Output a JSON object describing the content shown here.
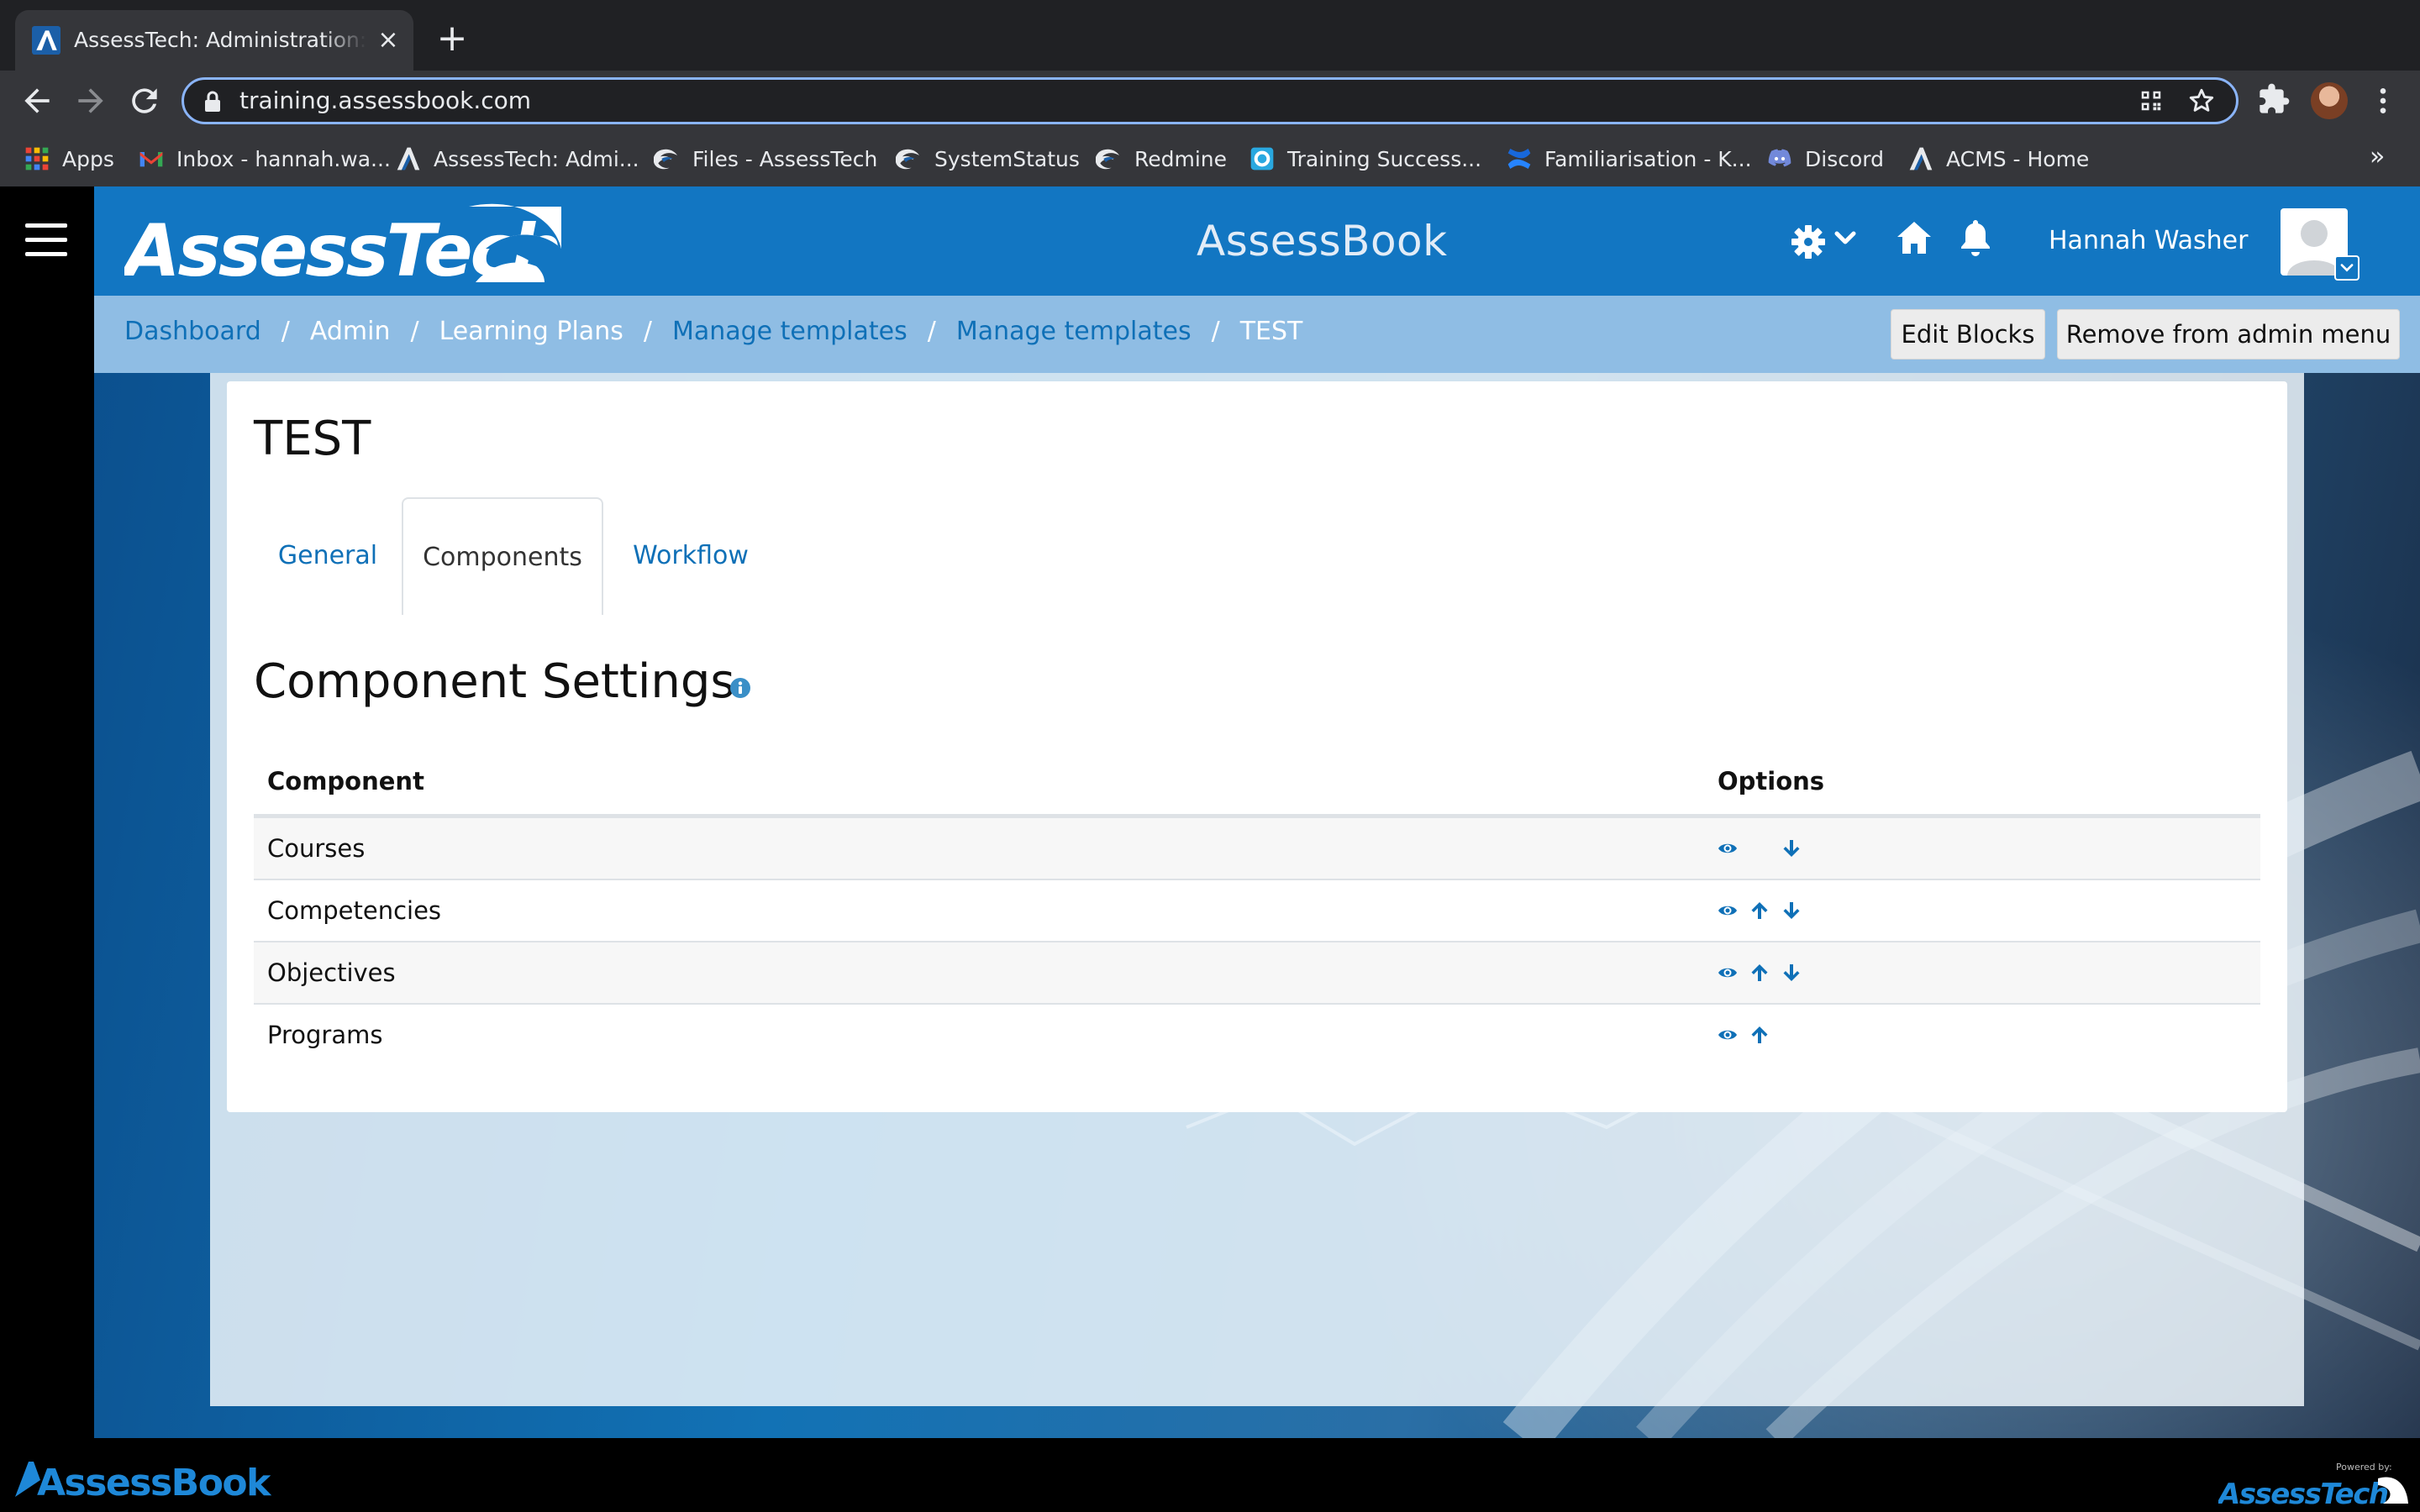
{
  "browser": {
    "tab_title": "AssessTech: Administration: Learning Plans",
    "url": "training.assessbook.com",
    "bookmarks": [
      {
        "label": "Apps",
        "icon": "apps-grid-icon"
      },
      {
        "label": "Inbox - hannah.wa...",
        "icon": "gmail-icon"
      },
      {
        "label": "AssessTech: Admi...",
        "icon": "assesstech-icon"
      },
      {
        "label": "Files - AssessTech",
        "icon": "swoosh-icon"
      },
      {
        "label": "SystemStatus",
        "icon": "swoosh-icon"
      },
      {
        "label": "Redmine",
        "icon": "swoosh-icon"
      },
      {
        "label": "Training Success...",
        "icon": "trainingsuccess-icon"
      },
      {
        "label": "Familiarisation - K...",
        "icon": "confluence-icon"
      },
      {
        "label": "Discord",
        "icon": "discord-icon"
      },
      {
        "label": "ACMS - Home",
        "icon": "assesstech-icon"
      }
    ],
    "more": "»"
  },
  "header": {
    "logo_text": "AssessTech",
    "title": "AssessBook",
    "user_name": "Hannah Washer"
  },
  "breadcrumb": {
    "items": [
      {
        "label": "Dashboard",
        "link": true
      },
      {
        "label": "Admin",
        "link": false
      },
      {
        "label": "Learning Plans",
        "link": false
      },
      {
        "label": "Manage templates",
        "link": true
      },
      {
        "label": "Manage templates",
        "link": true
      },
      {
        "label": "TEST",
        "link": false
      }
    ],
    "separator": "/"
  },
  "buttons": {
    "edit_blocks": "Edit Blocks",
    "remove_admin": "Remove from admin menu"
  },
  "page": {
    "heading": "TEST",
    "tabs": [
      {
        "label": "General",
        "active": false
      },
      {
        "label": "Components",
        "active": true
      },
      {
        "label": "Workflow",
        "active": false
      }
    ],
    "section_title": "Component Settings"
  },
  "table": {
    "headers": [
      "Component",
      "Options"
    ],
    "rows": [
      {
        "component": "Courses",
        "options": [
          "visibility",
          "move-down"
        ]
      },
      {
        "component": "Competencies",
        "options": [
          "visibility",
          "move-up",
          "move-down"
        ]
      },
      {
        "component": "Objectives",
        "options": [
          "visibility",
          "move-up",
          "move-down"
        ]
      },
      {
        "component": "Programs",
        "options": [
          "visibility",
          "move-up"
        ]
      }
    ]
  },
  "footer": {
    "logo_text": "AssessBook",
    "powered_by": "Powered by:",
    "powered_logo": "AssessTech"
  },
  "colors": {
    "brand_blue": "#1276c2",
    "link_blue": "#0f70b7",
    "breadcrumb_bar": "#8fbde4"
  }
}
